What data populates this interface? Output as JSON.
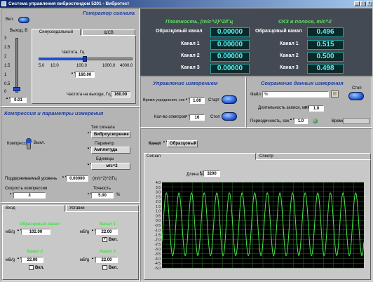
{
  "window": {
    "title": "Система управления вибростендом 5201 - Вибротест"
  },
  "generator": {
    "title": "Генератор сигнала",
    "enable_label": "Вкл.",
    "output_label": "Выход, В",
    "output_scale": [
      "3",
      "2.5",
      "2",
      "1.5",
      "1",
      "0.5",
      "0"
    ],
    "output_value": "0.01",
    "tabs": [
      "Синусоидальный",
      "ШСВ"
    ],
    "freq_label": "Частота, Гц",
    "freq_scale": [
      "5.0",
      "10.0",
      "100.0",
      "1000.0",
      "4000.0"
    ],
    "freq_value": "160.00",
    "out_freq_label": "Частота на выходе, Гц",
    "out_freq_value": "160.00"
  },
  "density": {
    "title": "Плотность, (m/c^2)^2/Гц",
    "rows": [
      {
        "label": "Образцовый канал",
        "value": "0.00000"
      },
      {
        "label": "Канал 1",
        "value": "0.00000"
      },
      {
        "label": "Канал 2",
        "value": "0.00000"
      },
      {
        "label": "Канал 3",
        "value": "0.00000"
      }
    ]
  },
  "rms": {
    "title": "СКЗ в полосе, m/c^2",
    "rows": [
      {
        "label": "Образцовый канал",
        "value": "0.496"
      },
      {
        "label": "Канал 1",
        "value": "0.515"
      },
      {
        "label": "Канал 2",
        "value": "0.500"
      },
      {
        "label": "Канал 3",
        "value": "0.498"
      }
    ]
  },
  "compression": {
    "title": "Компрессия и параметры измерения",
    "compression_label": "Компрессия",
    "off_label": "Выкл.",
    "signal_type_label": "Тип сигнала",
    "signal_type_value": "Виброускорение",
    "param_label": "Параметр",
    "param_value": "Амплитуда",
    "units_label": "Единицы",
    "units_value": "м/с^2",
    "level_label": "Поддерживаемый уровень",
    "level_value": "0.00000",
    "level_unit": "(m/c^2)^2/Гц",
    "speed_label": "Скорость компрессии",
    "speed_value": "3",
    "accuracy_label": "Точность",
    "accuracy_value": "5.00",
    "accuracy_unit": "%"
  },
  "inputs": {
    "tabs": [
      "Вход",
      "Уставки"
    ],
    "ref_label": "Образцовый канал",
    "ref_value": "102.00",
    "ch1_label": "Канал 1",
    "ch1_value": "22.00",
    "ch2_label": "Канал 2",
    "ch2_value": "22.00",
    "ch3_label": "Канал 3",
    "ch3_value": "22.00",
    "sens_unit": "мВ/g",
    "enable_label": "Вкл.",
    "check_mark": "✓"
  },
  "measure": {
    "title": "Управление измерением",
    "avg_label": "Время усреднения, сек",
    "avg_value": "1.00",
    "start_label": "Старт",
    "spectra_label": "Кол-во спектров",
    "spectra_value": "16",
    "stop_label": "Стоп"
  },
  "save": {
    "title": "Сохранение данных измерения",
    "file_label": "Файл",
    "file_value": "%",
    "stop_label": "Стоп",
    "duration_label": "Длительность записи, мин",
    "duration_value": "1.0",
    "period_label": "Периодичность, сек",
    "period_value": "1.0",
    "time_label": "Время"
  },
  "channel": {
    "label": "Канал",
    "value": "Образцовый"
  },
  "signal": {
    "tabs": [
      "Сигнал",
      "Спектр"
    ],
    "length_label": "Длина выборки",
    "length_value": "3200"
  },
  "chart_data": {
    "type": "line",
    "title": "",
    "xlabel": "",
    "ylabel": "",
    "yticks": [
      "4.0",
      "3.5",
      "3.0",
      "2.5",
      "2.0",
      "1.5",
      "1.0",
      "0.5",
      "0.0",
      "-0.5",
      "-1.0",
      "-1.5",
      "-2.0",
      "-2.5",
      "-3.0",
      "-3.5",
      "-4.0",
      "-4.5",
      "-5.0"
    ],
    "ylim": [
      -5.0,
      4.0
    ],
    "grid": true,
    "series": [
      {
        "amplitude": 3.3,
        "cycles": 16,
        "offset": -0.4
      }
    ],
    "colors": {
      "line": "#49e649",
      "background": "#000000",
      "grid": "#2f6b2f"
    }
  }
}
